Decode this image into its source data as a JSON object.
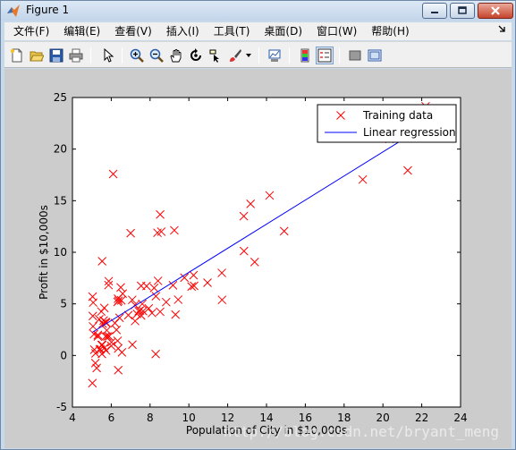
{
  "window": {
    "title": "Figure 1",
    "controls": {
      "minimize": "minimize",
      "maximize": "maximize",
      "close": "close"
    }
  },
  "menu": {
    "items": [
      "文件(F)",
      "编辑(E)",
      "查看(V)",
      "插入(I)",
      "工具(T)",
      "桌面(D)",
      "窗口(W)",
      "帮助(H)"
    ]
  },
  "toolbar": {
    "icons": [
      "new-figure-icon",
      "open-file-icon",
      "save-icon",
      "print-icon",
      "select-arrow-icon",
      "zoom-in-icon",
      "zoom-out-icon",
      "pan-icon",
      "rotate-3d-icon",
      "data-cursor-icon",
      "brush-icon",
      "brush-dropdown-icon",
      "link-plot-icon",
      "insert-colorbar-icon",
      "insert-legend-icon",
      "hide-plot-tools-icon",
      "show-plot-tools-icon"
    ]
  },
  "watermark": "http://blog.csdn.net/bryant_meng",
  "chart_data": {
    "type": "scatter",
    "xlabel": "Population of City in $10,000s",
    "ylabel": "Profit in $10,000s",
    "xlim": [
      4,
      24
    ],
    "ylim": [
      -5,
      25
    ],
    "xticks": [
      "4",
      "6",
      "8",
      "10",
      "12",
      "14",
      "16",
      "18",
      "20",
      "22",
      "24"
    ],
    "yticks": [
      "-5",
      "0",
      "5",
      "10",
      "15",
      "20",
      "25"
    ],
    "legend_position": "top-right",
    "grid": false,
    "colors": {
      "training": "#ff0000",
      "regression": "#0000ff"
    },
    "series": [
      {
        "name": "Training data",
        "marker": "x",
        "x": [
          6.1,
          5.53,
          8.52,
          7.0,
          5.86,
          8.38,
          7.48,
          8.58,
          6.49,
          5.05,
          5.71,
          14.16,
          5.73,
          8.41,
          5.64,
          5.38,
          6.37,
          5.13,
          6.43,
          7.08,
          6.19,
          20.27,
          5.49,
          6.33,
          5.56,
          18.95,
          12.83,
          10.96,
          13.18,
          22.2,
          5.25,
          6.59,
          9.25,
          5.89,
          8.21,
          7.93,
          8.1,
          5.61,
          12.84,
          6.35,
          5.41,
          6.88,
          11.71,
          5.77,
          7.82,
          7.09,
          5.07,
          5.8,
          11.7,
          5.54,
          7.54,
          5.31,
          7.42,
          7.6,
          6.33,
          6.36,
          6.27,
          5.64,
          9.31,
          9.45,
          8.83,
          5.18,
          21.28,
          14.91,
          18.96,
          7.22,
          8.3,
          10.24,
          5.5,
          20.34,
          10.14,
          7.33,
          6.01,
          7.23,
          5.03,
          6.55,
          7.54,
          5.04,
          10.27,
          5.11,
          5.73,
          5.19,
          6.36,
          9.77,
          6.52,
          8.52,
          9.18,
          6.0,
          5.52,
          5.06,
          5.71,
          7.64,
          5.87,
          5.31,
          8.29,
          13.39,
          5.44
        ],
        "y": [
          17.59,
          9.13,
          13.66,
          11.85,
          6.82,
          11.89,
          4.35,
          12.0,
          6.6,
          3.82,
          3.25,
          15.51,
          3.16,
          7.23,
          0.72,
          3.51,
          5.3,
          0.56,
          3.65,
          5.39,
          3.14,
          21.77,
          4.26,
          5.19,
          3.08,
          22.64,
          13.5,
          7.05,
          14.69,
          24.15,
          -1.22,
          5.99,
          12.13,
          1.85,
          6.54,
          4.56,
          4.12,
          3.39,
          10.12,
          5.5,
          0.56,
          3.91,
          5.39,
          2.44,
          6.73,
          1.05,
          5.13,
          1.84,
          8.0,
          1.02,
          6.75,
          1.84,
          4.29,
          5.0,
          1.42,
          -1.42,
          2.48,
          4.6,
          3.96,
          5.41,
          5.17,
          -0.74,
          17.93,
          12.05,
          17.05,
          4.89,
          5.74,
          7.78,
          1.02,
          20.99,
          6.68,
          4.03,
          1.28,
          3.34,
          -2.68,
          0.3,
          3.88,
          5.7,
          6.75,
          2.06,
          0.48,
          0.2,
          0.68,
          7.54,
          5.34,
          4.24,
          6.8,
          0.93,
          0.15,
          2.82,
          1.85,
          4.3,
          7.2,
          1.99,
          0.14,
          9.06,
          0.62
        ]
      },
      {
        "name": "Linear regression",
        "marker": "line",
        "x": [
          5.03,
          22.2
        ],
        "y": [
          2.25,
          22.3
        ]
      }
    ]
  }
}
